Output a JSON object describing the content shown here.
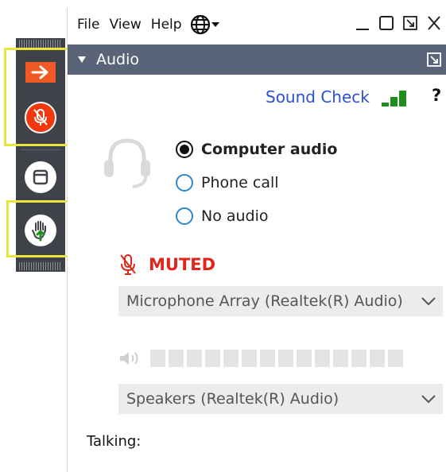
{
  "menu": {
    "file": "File",
    "view": "View",
    "help": "Help"
  },
  "audio_panel": {
    "header_title": "Audio",
    "sound_check": "Sound Check",
    "help_symbol": "?",
    "options": [
      {
        "label": "Computer audio",
        "selected": true
      },
      {
        "label": "Phone call",
        "selected": false
      },
      {
        "label": "No audio",
        "selected": false
      }
    ],
    "muted_label": "MUTED",
    "microphone": "Microphone Array (Realtek(R) Audio)",
    "speakers": "Speakers (Realtek(R) Audio)",
    "talking_label": "Talking:"
  },
  "colors": {
    "toolbar_bg": "#3f4349",
    "header_bg": "#5a6478",
    "accent_orange": "#f15a24",
    "mute_red": "#e0261a",
    "link_blue": "#2b4fd4",
    "signal_green": "#1e8f1e",
    "highlight_yellow": "#e6e63c"
  },
  "icons": {
    "toolbar": [
      "arrow-right-icon",
      "mic-muted-icon",
      "window-icon",
      "raise-hand-icon"
    ],
    "menubar": [
      "globe-icon",
      "minimize-icon",
      "maximize-icon",
      "popout-icon",
      "close-icon"
    ],
    "panel": [
      "headset-icon",
      "signal-bars-icon",
      "mic-muted-icon",
      "speaker-icon",
      "chevron-down-icon"
    ]
  }
}
